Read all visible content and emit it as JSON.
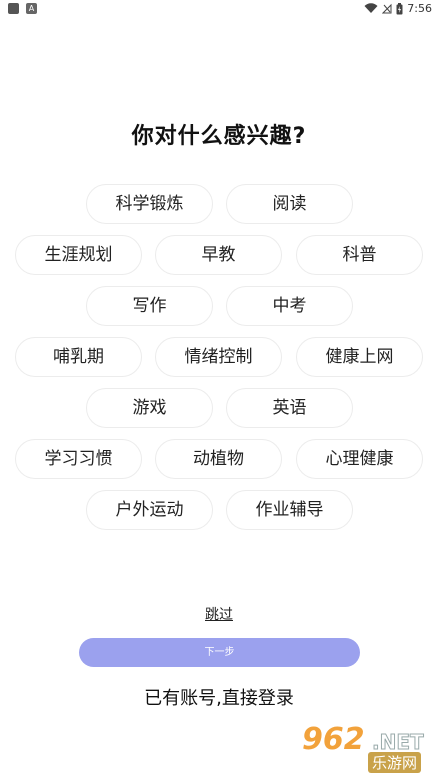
{
  "status": {
    "time": "7:56"
  },
  "title": "你对什么感兴趣?",
  "interests": [
    "科学锻炼",
    "阅读",
    "生涯规划",
    "早教",
    "科普",
    "写作",
    "中考",
    "哺乳期",
    "情绪控制",
    "健康上网",
    "游戏",
    "英语",
    "学习习惯",
    "动植物",
    "心理健康",
    "户外运动",
    "作业辅导"
  ],
  "skip_label": "跳过",
  "next_label": "下一步",
  "login_label": "已有账号,直接登录",
  "watermark": {
    "number": "962",
    "domain": ".NET",
    "sub": "乐游网"
  },
  "colors": {
    "primary": "#9ba1ee",
    "accent": "#f2a23b"
  }
}
